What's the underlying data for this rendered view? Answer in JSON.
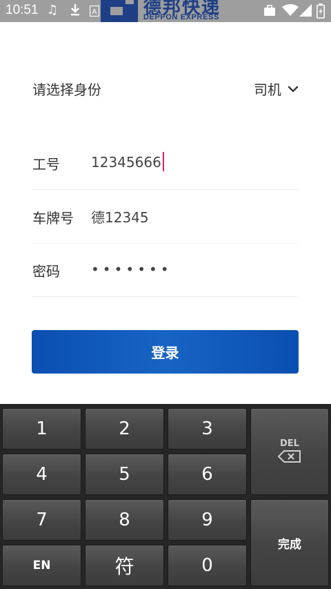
{
  "status_bar": {
    "time": "10:51",
    "logo_cn": "德邦快递",
    "logo_en": "DEPPON EXPRESS",
    "icons": [
      "music-note-icon",
      "download-icon",
      "keyboard-a-icon",
      "briefcase-icon",
      "wifi-icon",
      "signal-icon",
      "battery-charging-icon"
    ]
  },
  "role": {
    "label": "请选择身份",
    "value": "司机"
  },
  "form": {
    "employee_id": {
      "label": "工号",
      "value": "12345666"
    },
    "plate": {
      "label": "车牌号",
      "value": "德12345"
    },
    "password": {
      "label": "密码",
      "value": "•••••••"
    }
  },
  "login": {
    "label": "登录"
  },
  "keyboard": {
    "keys": {
      "k1": "1",
      "k2": "2",
      "k3": "3",
      "k4": "4",
      "k5": "5",
      "k6": "6",
      "k7": "7",
      "k8": "8",
      "k9": "9",
      "en": "EN",
      "symbol": "符",
      "k0": "0",
      "del": "DEL",
      "done": "完成"
    }
  },
  "colors": {
    "accent": "#0a4fb1",
    "caret": "#e91e63",
    "logo": "#1e3f86",
    "status_bar": "#9e9e9e",
    "keyboard_bg": "#262626"
  }
}
